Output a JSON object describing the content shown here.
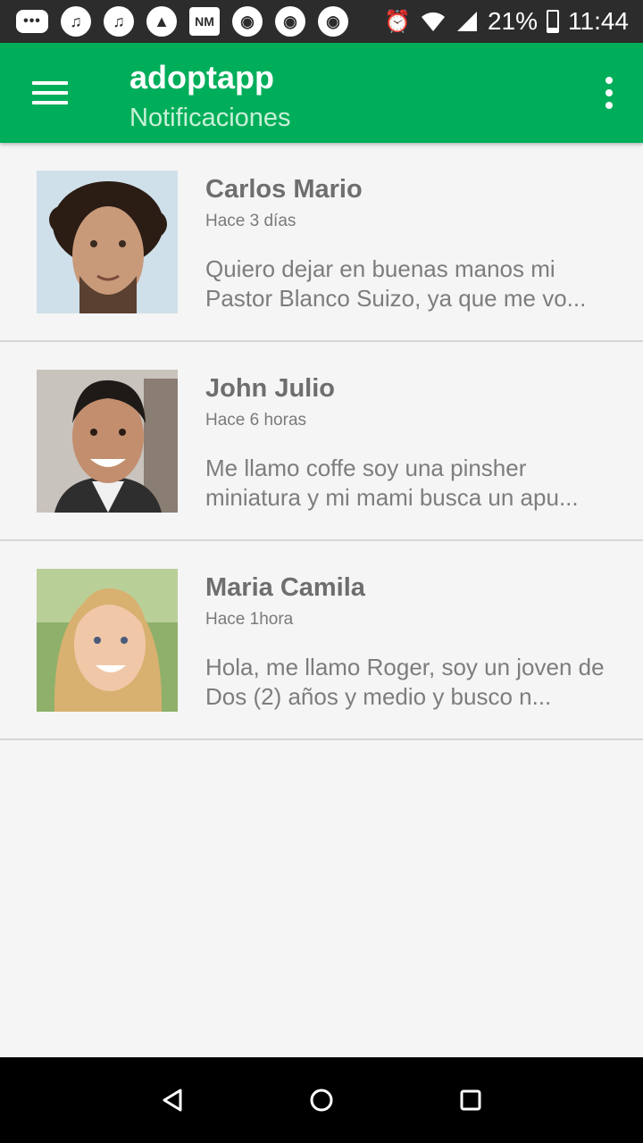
{
  "status_bar": {
    "left_icons": [
      {
        "icon": "messages-icon",
        "glyph": "•••"
      },
      {
        "icon": "music-note-icon",
        "glyph": "♫"
      },
      {
        "icon": "music-note-icon",
        "glyph": "♫"
      },
      {
        "icon": "drive-icon",
        "glyph": "▲"
      },
      {
        "icon": "nm-app-icon",
        "glyph": "NM"
      },
      {
        "icon": "chrome-icon",
        "glyph": "◉"
      },
      {
        "icon": "chrome-icon",
        "glyph": "◉"
      },
      {
        "icon": "chrome-icon",
        "glyph": "◉"
      }
    ],
    "battery_percent": "21%",
    "time": "11:44"
  },
  "app_bar": {
    "title": "adoptapp",
    "subtitle": "Notificaciones",
    "color": "#00ae5a"
  },
  "notifications": [
    {
      "name": "Carlos Mario",
      "time": "Hace 3 días",
      "message": "Quiero dejar en buenas manos mi Pastor Blanco Suizo, ya que me vo..."
    },
    {
      "name": "John Julio",
      "time": "Hace 6 horas",
      "message": "Me llamo coffe soy una pinsher miniatura y mi mami busca un apu..."
    },
    {
      "name": "Maria Camila",
      "time": "Hace 1hora",
      "message": "Hola, me llamo Roger, soy un joven de Dos (2) años y medio y busco n..."
    }
  ]
}
